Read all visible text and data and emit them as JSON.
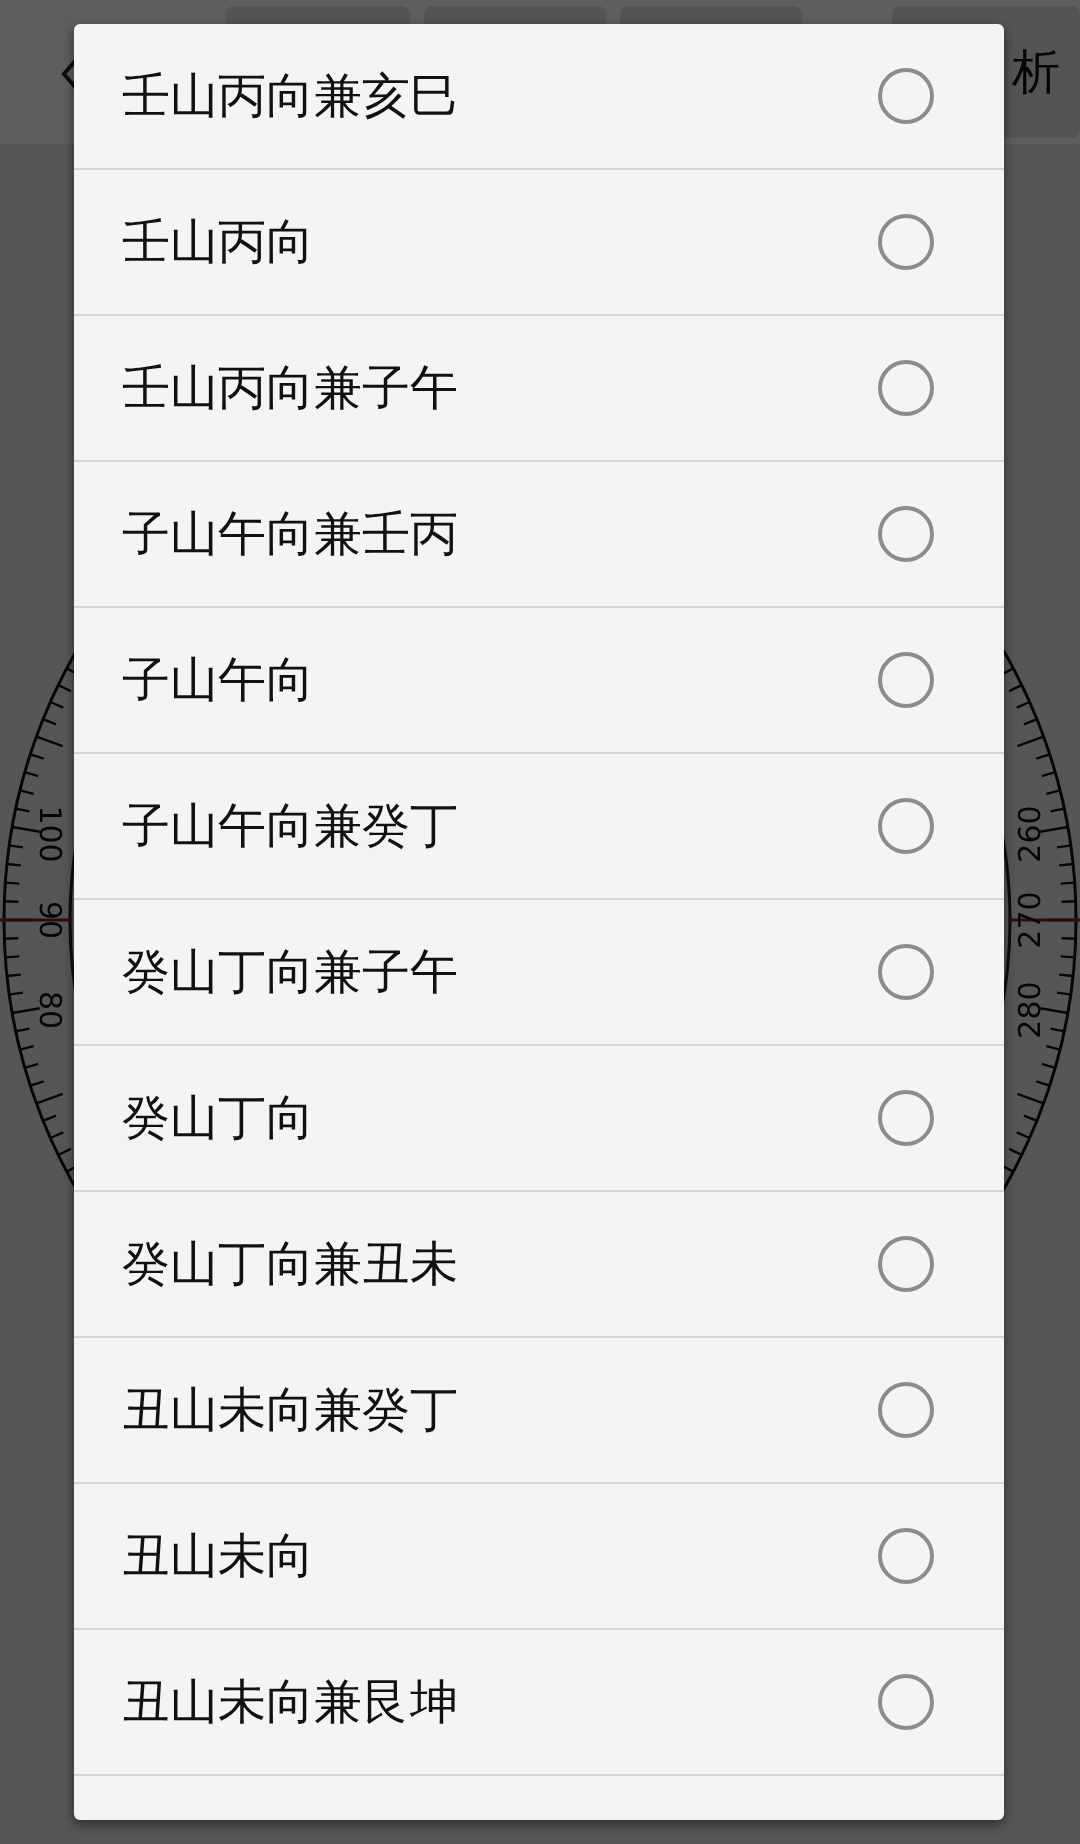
{
  "toolbar": {
    "trailing_label": "析"
  },
  "compass": {
    "left_labels": [
      "100",
      "90",
      "80"
    ],
    "right_labels": [
      "260",
      "270",
      "280"
    ]
  },
  "dialog": {
    "options": [
      {
        "label": "壬山丙向兼亥巳",
        "selected": false
      },
      {
        "label": "壬山丙向",
        "selected": false
      },
      {
        "label": "壬山丙向兼子午",
        "selected": false
      },
      {
        "label": "子山午向兼壬丙",
        "selected": false
      },
      {
        "label": "子山午向",
        "selected": false
      },
      {
        "label": "子山午向兼癸丁",
        "selected": false
      },
      {
        "label": "癸山丁向兼子午",
        "selected": false
      },
      {
        "label": "癸山丁向",
        "selected": false
      },
      {
        "label": "癸山丁向兼丑未",
        "selected": false
      },
      {
        "label": "丑山未向兼癸丁",
        "selected": false
      },
      {
        "label": "丑山未向",
        "selected": false
      },
      {
        "label": "丑山未向兼艮坤",
        "selected": false
      }
    ]
  }
}
